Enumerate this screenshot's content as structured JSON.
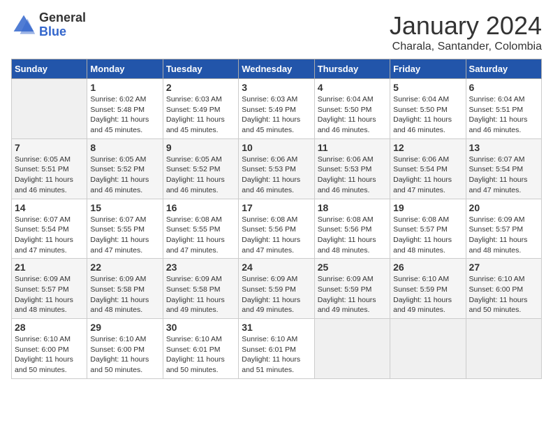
{
  "header": {
    "logo": {
      "line1": "General",
      "line2": "Blue"
    },
    "title": "January 2024",
    "subtitle": "Charala, Santander, Colombia"
  },
  "weekdays": [
    "Sunday",
    "Monday",
    "Tuesday",
    "Wednesday",
    "Thursday",
    "Friday",
    "Saturday"
  ],
  "weeks": [
    [
      {
        "day": "",
        "info": ""
      },
      {
        "day": "1",
        "info": "Sunrise: 6:02 AM\nSunset: 5:48 PM\nDaylight: 11 hours\nand 45 minutes."
      },
      {
        "day": "2",
        "info": "Sunrise: 6:03 AM\nSunset: 5:49 PM\nDaylight: 11 hours\nand 45 minutes."
      },
      {
        "day": "3",
        "info": "Sunrise: 6:03 AM\nSunset: 5:49 PM\nDaylight: 11 hours\nand 45 minutes."
      },
      {
        "day": "4",
        "info": "Sunrise: 6:04 AM\nSunset: 5:50 PM\nDaylight: 11 hours\nand 46 minutes."
      },
      {
        "day": "5",
        "info": "Sunrise: 6:04 AM\nSunset: 5:50 PM\nDaylight: 11 hours\nand 46 minutes."
      },
      {
        "day": "6",
        "info": "Sunrise: 6:04 AM\nSunset: 5:51 PM\nDaylight: 11 hours\nand 46 minutes."
      }
    ],
    [
      {
        "day": "7",
        "info": "Sunrise: 6:05 AM\nSunset: 5:51 PM\nDaylight: 11 hours\nand 46 minutes."
      },
      {
        "day": "8",
        "info": "Sunrise: 6:05 AM\nSunset: 5:52 PM\nDaylight: 11 hours\nand 46 minutes."
      },
      {
        "day": "9",
        "info": "Sunrise: 6:05 AM\nSunset: 5:52 PM\nDaylight: 11 hours\nand 46 minutes."
      },
      {
        "day": "10",
        "info": "Sunrise: 6:06 AM\nSunset: 5:53 PM\nDaylight: 11 hours\nand 46 minutes."
      },
      {
        "day": "11",
        "info": "Sunrise: 6:06 AM\nSunset: 5:53 PM\nDaylight: 11 hours\nand 46 minutes."
      },
      {
        "day": "12",
        "info": "Sunrise: 6:06 AM\nSunset: 5:54 PM\nDaylight: 11 hours\nand 47 minutes."
      },
      {
        "day": "13",
        "info": "Sunrise: 6:07 AM\nSunset: 5:54 PM\nDaylight: 11 hours\nand 47 minutes."
      }
    ],
    [
      {
        "day": "14",
        "info": "Sunrise: 6:07 AM\nSunset: 5:54 PM\nDaylight: 11 hours\nand 47 minutes."
      },
      {
        "day": "15",
        "info": "Sunrise: 6:07 AM\nSunset: 5:55 PM\nDaylight: 11 hours\nand 47 minutes."
      },
      {
        "day": "16",
        "info": "Sunrise: 6:08 AM\nSunset: 5:55 PM\nDaylight: 11 hours\nand 47 minutes."
      },
      {
        "day": "17",
        "info": "Sunrise: 6:08 AM\nSunset: 5:56 PM\nDaylight: 11 hours\nand 47 minutes."
      },
      {
        "day": "18",
        "info": "Sunrise: 6:08 AM\nSunset: 5:56 PM\nDaylight: 11 hours\nand 48 minutes."
      },
      {
        "day": "19",
        "info": "Sunrise: 6:08 AM\nSunset: 5:57 PM\nDaylight: 11 hours\nand 48 minutes."
      },
      {
        "day": "20",
        "info": "Sunrise: 6:09 AM\nSunset: 5:57 PM\nDaylight: 11 hours\nand 48 minutes."
      }
    ],
    [
      {
        "day": "21",
        "info": "Sunrise: 6:09 AM\nSunset: 5:57 PM\nDaylight: 11 hours\nand 48 minutes."
      },
      {
        "day": "22",
        "info": "Sunrise: 6:09 AM\nSunset: 5:58 PM\nDaylight: 11 hours\nand 48 minutes."
      },
      {
        "day": "23",
        "info": "Sunrise: 6:09 AM\nSunset: 5:58 PM\nDaylight: 11 hours\nand 49 minutes."
      },
      {
        "day": "24",
        "info": "Sunrise: 6:09 AM\nSunset: 5:59 PM\nDaylight: 11 hours\nand 49 minutes."
      },
      {
        "day": "25",
        "info": "Sunrise: 6:09 AM\nSunset: 5:59 PM\nDaylight: 11 hours\nand 49 minutes."
      },
      {
        "day": "26",
        "info": "Sunrise: 6:10 AM\nSunset: 5:59 PM\nDaylight: 11 hours\nand 49 minutes."
      },
      {
        "day": "27",
        "info": "Sunrise: 6:10 AM\nSunset: 6:00 PM\nDaylight: 11 hours\nand 50 minutes."
      }
    ],
    [
      {
        "day": "28",
        "info": "Sunrise: 6:10 AM\nSunset: 6:00 PM\nDaylight: 11 hours\nand 50 minutes."
      },
      {
        "day": "29",
        "info": "Sunrise: 6:10 AM\nSunset: 6:00 PM\nDaylight: 11 hours\nand 50 minutes."
      },
      {
        "day": "30",
        "info": "Sunrise: 6:10 AM\nSunset: 6:01 PM\nDaylight: 11 hours\nand 50 minutes."
      },
      {
        "day": "31",
        "info": "Sunrise: 6:10 AM\nSunset: 6:01 PM\nDaylight: 11 hours\nand 51 minutes."
      },
      {
        "day": "",
        "info": ""
      },
      {
        "day": "",
        "info": ""
      },
      {
        "day": "",
        "info": ""
      }
    ]
  ]
}
